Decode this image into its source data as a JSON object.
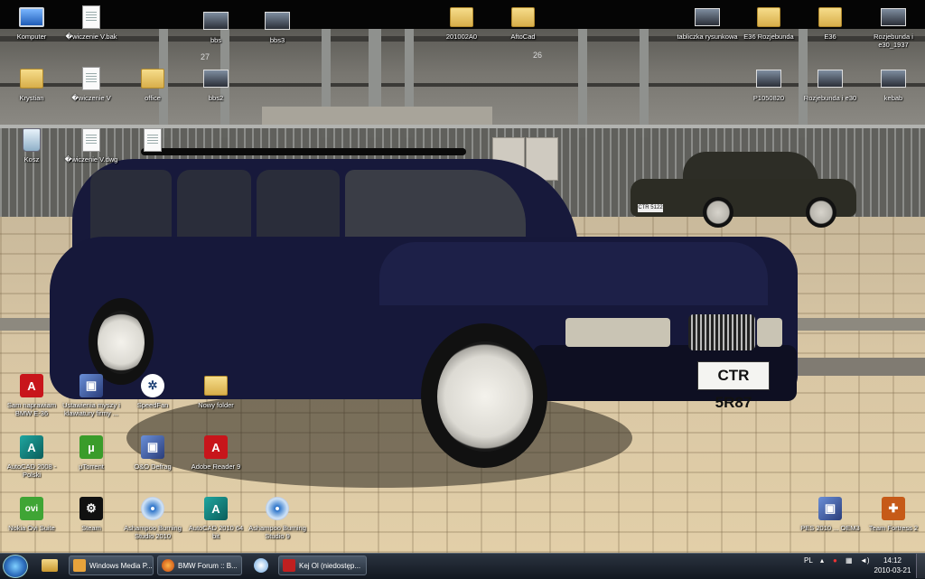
{
  "desktop": {
    "icons": [
      {
        "id": "komputer",
        "label": "Komputer",
        "glyph": "pc"
      },
      {
        "id": "cwiczenie-v-bak",
        "label": "�wiczenie V.bak",
        "glyph": "doc"
      },
      {
        "id": "bbs",
        "label": "bbs",
        "glyph": "img"
      },
      {
        "id": "bbs3",
        "label": "bbs3",
        "glyph": "img"
      },
      {
        "id": "201002a0",
        "label": "201002A0",
        "glyph": "folder"
      },
      {
        "id": "autocad",
        "label": "AftoCad",
        "glyph": "folder"
      },
      {
        "id": "tabliczka",
        "label": "tabliczka rysunkowa",
        "glyph": "img"
      },
      {
        "id": "e36-rozjebunda",
        "label": "E36 Rozjebunda",
        "glyph": "folder"
      },
      {
        "id": "e36",
        "label": "E36",
        "glyph": "folder"
      },
      {
        "id": "rozjebunda-e30-1937",
        "label": "Rozjebunda i e30_1937",
        "glyph": "img"
      },
      {
        "id": "krystian",
        "label": "Krystian",
        "glyph": "folder"
      },
      {
        "id": "cwiczenie-v",
        "label": "�wiczenie V",
        "glyph": "doc"
      },
      {
        "id": "office",
        "label": "office",
        "glyph": "folder"
      },
      {
        "id": "bbs2",
        "label": "bbs2",
        "glyph": "img"
      },
      {
        "id": "p1050820",
        "label": "P1050820",
        "glyph": "img"
      },
      {
        "id": "rozjebunda-e30",
        "label": "Rozjebunda i e30",
        "glyph": "img"
      },
      {
        "id": "kebab",
        "label": "kebab",
        "glyph": "img"
      },
      {
        "id": "kosz",
        "label": "Kosz",
        "glyph": "trash"
      },
      {
        "id": "doc-a",
        "label": "�wiczenie V.dwg",
        "glyph": "doc"
      },
      {
        "id": "doc-b",
        "label": "",
        "glyph": "doc"
      },
      {
        "id": "sam-naprawiam",
        "label": "Sam naprawiam BMW E-36",
        "glyph": "pdf"
      },
      {
        "id": "ustawienia",
        "label": "Ustawienia myszy i klawiatury firmy ...",
        "glyph": "app"
      },
      {
        "id": "speedfan",
        "label": "SpeedFan",
        "glyph": "fan"
      },
      {
        "id": "nowy-folder",
        "label": "Nowy folder",
        "glyph": "folder"
      },
      {
        "id": "autocad-2008",
        "label": "AutoCAD 2008 - Polski",
        "glyph": "autocad"
      },
      {
        "id": "utorrent",
        "label": "µTorrent",
        "glyph": "utorrent"
      },
      {
        "id": "o-o-defrag",
        "label": "O&O Defrag",
        "glyph": "app"
      },
      {
        "id": "adobe-reader",
        "label": "Adobe Reader 9",
        "glyph": "pdf"
      },
      {
        "id": "nokia-ovi",
        "label": "Nokia Ovi Suite",
        "glyph": "ovi"
      },
      {
        "id": "steam",
        "label": "Steam",
        "glyph": "steam"
      },
      {
        "id": "ashampoo-2010",
        "label": "Ashampoo Burning Studio 2010",
        "glyph": "disc"
      },
      {
        "id": "autocad-2010",
        "label": "AutoCAD 2010 64 bit",
        "glyph": "autocad"
      },
      {
        "id": "ashampoo-9",
        "label": "Ashampoo Burning Studio 9",
        "glyph": "disc"
      },
      {
        "id": "pes",
        "label": "PES 2010 ... OEM3",
        "glyph": "app"
      },
      {
        "id": "team-fortress",
        "label": "Team Fortress 2",
        "glyph": "tf2"
      }
    ]
  },
  "wallpaper": {
    "plate_text": "CTR 5R87",
    "small_plate_text": "CTR 5122",
    "stand_numbers": [
      "27",
      "26"
    ]
  },
  "taskbar": {
    "windows": [
      {
        "label": "Windows Media P...",
        "color": "#e8a33b"
      },
      {
        "label": "BMW Forum :: B...",
        "color": "#e2571e"
      },
      {
        "label": "Kej Ol (niedostęp...",
        "color": "#c02020"
      }
    ],
    "tray_lang": "PL",
    "clock_time": "14:12",
    "clock_date": "2010-03-21"
  },
  "colors": {
    "taskbar": "#1a212b",
    "car": "#16183a"
  }
}
